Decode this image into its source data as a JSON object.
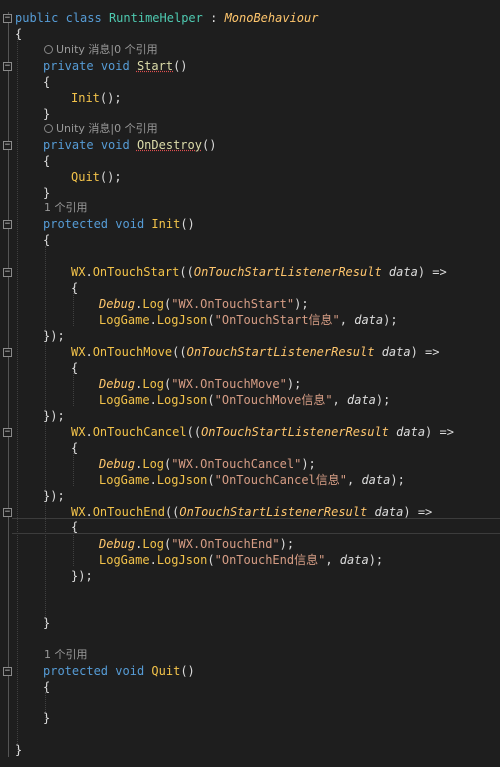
{
  "code": {
    "class_decl": {
      "kw1": "public",
      "kw2": "class",
      "name": "RuntimeHelper",
      "sep": " : ",
      "base": "MonoBehaviour"
    },
    "brace_open": "{",
    "brace_close": "}",
    "lens_unity": "Unity 消息|0 个引用",
    "lens_ref1": "1 个引用",
    "kw_private": "private",
    "kw_protected": "protected",
    "kw_void": "void",
    "m_start": "Start",
    "m_ondestroy": "OnDestroy",
    "m_init": "Init",
    "m_quit": "Quit",
    "parens": "()",
    "call_end": "();",
    "wx": "WX",
    "dot": ".",
    "ev_start": "OnTouchStart",
    "ev_move": "OnTouchMove",
    "ev_cancel": "OnTouchCancel",
    "ev_end": "OnTouchEnd",
    "listener_open": "((",
    "listener_type": "OnTouchStartListenerResult",
    "param": "data",
    "arrow": ") =>",
    "close_lambda": "});",
    "debug": "Debug",
    "log": "Log",
    "loggame": "LogGame",
    "logjson": "LogJson",
    "s_start": "\"WX.OnTouchStart\"",
    "s_move": "\"WX.OnTouchMove\"",
    "s_cancel": "\"WX.OnTouchCancel\"",
    "s_end": "\"WX.OnTouchEnd\"",
    "j_start": "\"OnTouchStart信息\"",
    "j_move": "\"OnTouchMove信息\"",
    "j_cancel": "\"OnTouchCancel信息\"",
    "j_end": "\"OnTouchEnd信息\"",
    "open_paren": "(",
    "close_semicolon": ");",
    "comma": ", "
  }
}
